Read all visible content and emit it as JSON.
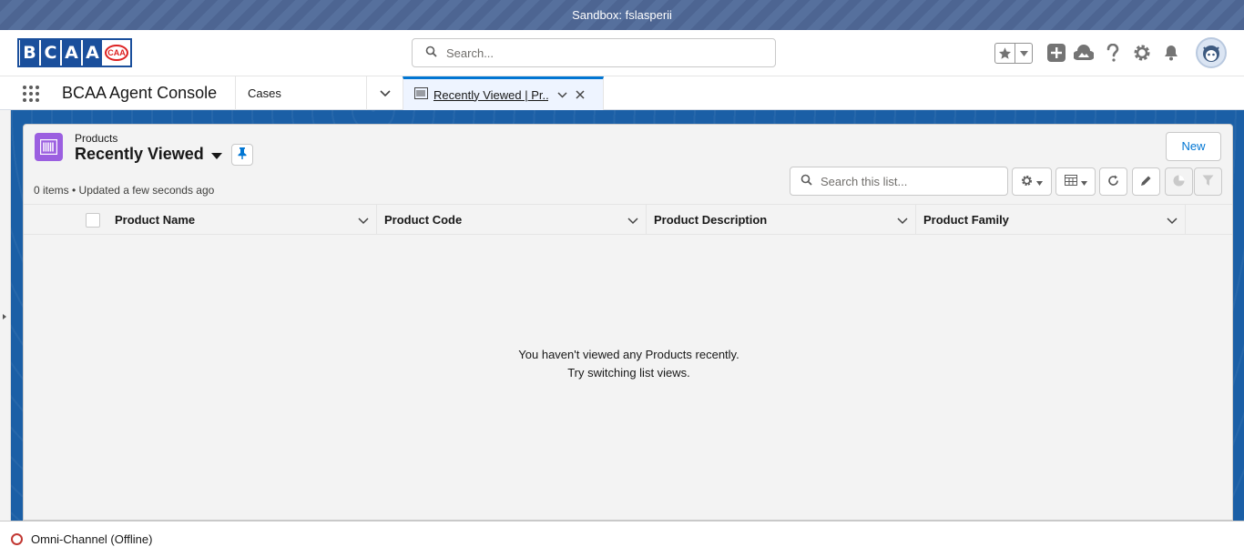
{
  "sandbox": {
    "label": "Sandbox: fslasperii"
  },
  "header": {
    "logo_letters": [
      "B",
      "C",
      "A",
      "A"
    ],
    "logo_badge": "CAA",
    "search_placeholder": "Search..."
  },
  "nav": {
    "app_name": "BCAA Agent Console",
    "items": [
      {
        "label": "Cases"
      }
    ],
    "active_tab": {
      "label": "Recently Viewed | Pr..."
    }
  },
  "list_view": {
    "object_label": "Products",
    "view_name": "Recently Viewed",
    "new_button": "New",
    "meta": "0 items • Updated a few seconds ago",
    "search_placeholder": "Search this list...",
    "columns": [
      "Product Name",
      "Product Code",
      "Product Description",
      "Product Family"
    ],
    "empty_line1": "You haven't viewed any Products recently.",
    "empty_line2": "Try switching list views."
  },
  "utility": {
    "omni_channel": "Omni-Channel (Offline)"
  },
  "icons": {
    "search": "search-icon",
    "favorites": "star-icon",
    "add": "plus-icon",
    "guidance": "trailhead-icon",
    "help": "question-icon",
    "setup": "gear-icon",
    "notifications": "bell-icon",
    "pin": "pin-icon",
    "refresh": "refresh-icon",
    "edit": "pencil-icon",
    "chart": "chart-icon",
    "filter": "filter-icon"
  },
  "colors": {
    "brand": "#0176d3",
    "sandbox_bar": "#4d6592",
    "object_icon": "#9b5fe0",
    "offline": "#c23934"
  }
}
